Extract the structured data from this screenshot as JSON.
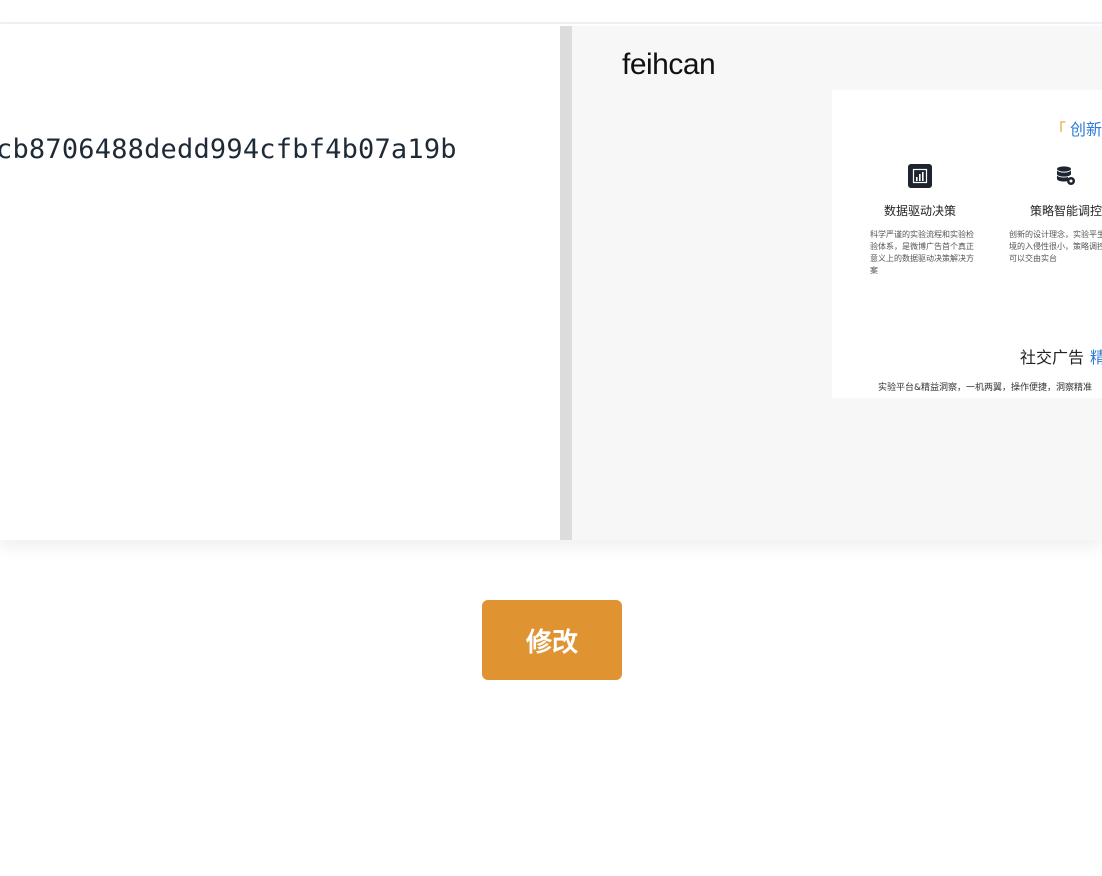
{
  "editor": {
    "hash_value": "cb8706488dedd994cfbf4b07a19b"
  },
  "preview": {
    "brand": "feihcan",
    "card": {
      "heading_bracket": "「",
      "heading_word": "创新",
      "features": [
        {
          "icon": "bar-chart-icon",
          "title": "数据驱动决策",
          "description": "科学严谨的实验流程和实验检验体系，是微博广告首个真正意义上的数据驱动决策解决方案"
        },
        {
          "icon": "database-gear-icon",
          "title": "策略智能调控",
          "description": "创新的设计理念，实验平生产环境的入侵性很小，策略调控完全可以交由实台"
        }
      ],
      "sub_heading": "社交广告",
      "sub_heading_accent": "精",
      "tagline": "实验平台&精益洞察，一机两翼，操作便捷，洞察精准"
    }
  },
  "actions": {
    "edit_label": "修改"
  },
  "colors": {
    "accent_orange": "#df9431",
    "accent_blue": "#2e7bd6",
    "bracket_orange": "#e8a23a"
  }
}
